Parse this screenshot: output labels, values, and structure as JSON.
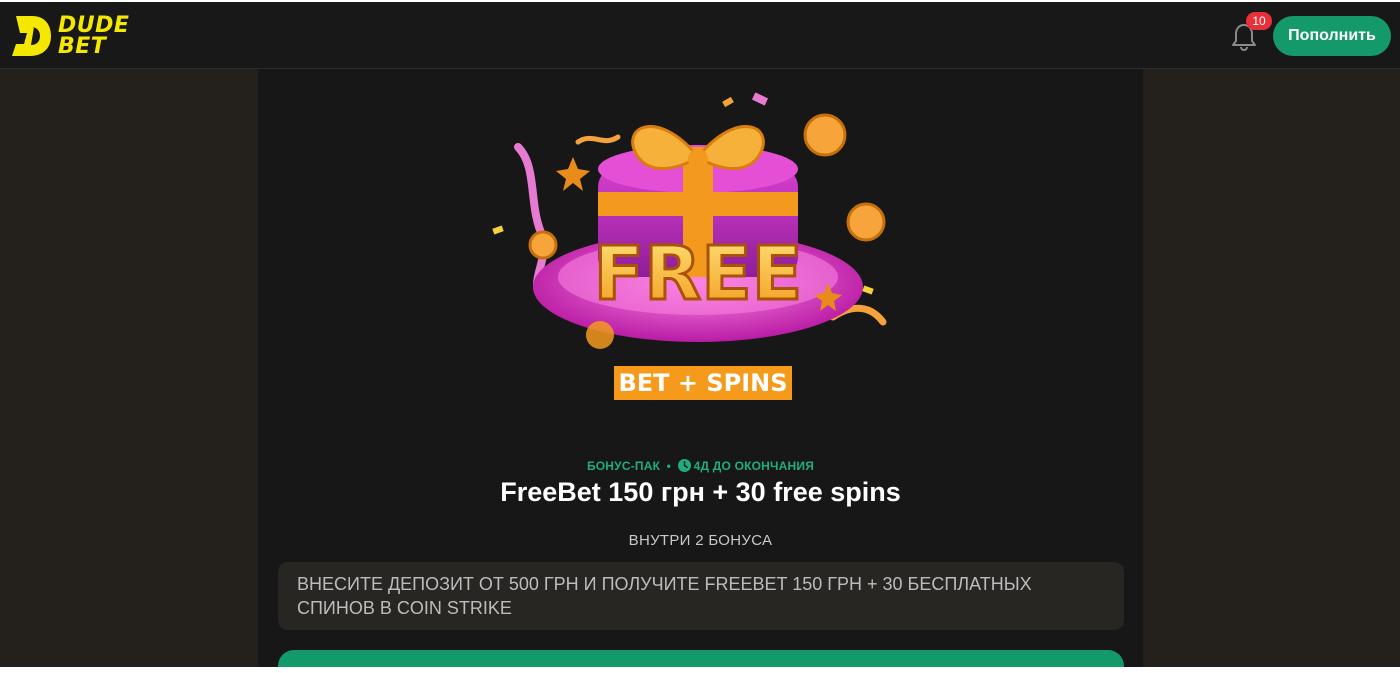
{
  "header": {
    "logo": {
      "line1": "DUDE",
      "line2": "BET"
    },
    "notifications": {
      "count": "10"
    },
    "deposit_button": "Пополнить"
  },
  "bonus": {
    "type_label": "БОНУС-ПАК",
    "separator": "•",
    "expires_label": "4Д ДО ОКОНЧАНИЯ",
    "title": "FreeBet 150 грн + 30 free spins",
    "inside_label": "ВНУТРИ 2 БОНУСА",
    "description": "ВНЕСИТЕ ДЕПОЗИТ ОТ 500 ГРН И ПОЛУЧИТЕ FREEBET 150 ГРН + 30 БЕСПЛАТНЫХ СПИНОВ В COIN STRIKE",
    "image": {
      "main_text": "FREE",
      "ribbon_text": "BET + SPINS"
    }
  },
  "colors": {
    "accent_green": "#14996a",
    "logo_yellow": "#f5e800",
    "badge_red": "#e8303a"
  }
}
